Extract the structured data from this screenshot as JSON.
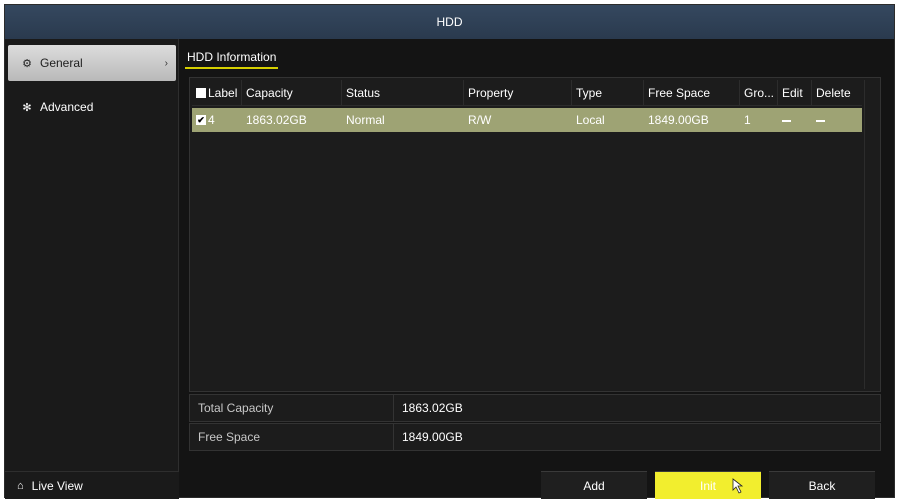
{
  "window": {
    "title": "HDD"
  },
  "sidebar": {
    "items": [
      {
        "label": "General",
        "icon": "gear-icon",
        "active": true
      },
      {
        "label": "Advanced",
        "icon": "cog-icon",
        "active": false
      }
    ],
    "live_view": {
      "label": "Live View",
      "icon": "home-icon"
    }
  },
  "tab": {
    "label": "HDD Information"
  },
  "table": {
    "columns": [
      "Label",
      "Capacity",
      "Status",
      "Property",
      "Type",
      "Free Space",
      "Gro...",
      "Edit",
      "Delete"
    ],
    "rows": [
      {
        "label": "4",
        "capacity": "1863.02GB",
        "status": "Normal",
        "property": "R/W",
        "type": "Local",
        "free_space": "1849.00GB",
        "group": "1",
        "edit": "–",
        "delete": "–"
      }
    ]
  },
  "summary": {
    "total_capacity_label": "Total Capacity",
    "total_capacity_value": "1863.02GB",
    "free_space_label": "Free Space",
    "free_space_value": "1849.00GB"
  },
  "buttons": {
    "add": "Add",
    "init": "Init",
    "back": "Back"
  },
  "colors": {
    "accent": "#f2ee2e",
    "selected_row": "#9ea374",
    "titlebar": "#2f4055"
  }
}
